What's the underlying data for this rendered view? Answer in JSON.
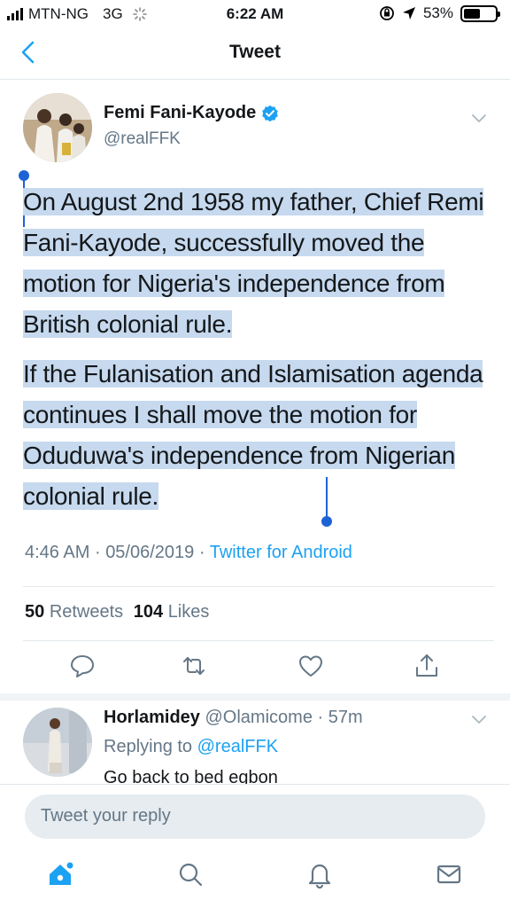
{
  "status_bar": {
    "carrier": "MTN-NG",
    "network": "3G",
    "time": "6:22 AM",
    "battery": "53%",
    "battery_level": 0.53
  },
  "nav": {
    "title": "Tweet",
    "back_icon": "chevron-left-icon"
  },
  "tweet": {
    "author_name": "Femi Fani-Kayode",
    "author_handle": "@realFFK",
    "paragraph_1": "On August 2nd 1958 my father, Chief Remi Fani-Kayode, successfully moved the motion for Nigeria's independence from British colonial rule.",
    "paragraph_2": "If the Fulanisation and Islamisation agenda continues I shall move the motion for Oduduwa's independence from Nigerian colonial rule.",
    "time": "4:46 AM",
    "sep": "·",
    "date": "05/06/2019",
    "source": "Twitter for Android",
    "retweet_count": "50",
    "retweet_label": "Retweets",
    "like_count": "104",
    "like_label": "Likes"
  },
  "reply": {
    "author_name": "Horlamidey",
    "author_handle": "@Olamicome",
    "sep": "·",
    "age": "57m",
    "replying_prefix": "Replying to",
    "replying_mention": "@realFFK",
    "text": "Go back to bed egbon"
  },
  "composer": {
    "placeholder": "Tweet your reply"
  },
  "tabs": [
    "home-icon",
    "search-icon",
    "notifications-icon",
    "messages-icon"
  ],
  "colors": {
    "accent": "#1da1f2",
    "selection": "#c6d9ee",
    "selection_handle": "#1d63d6",
    "secondary_text": "#657786"
  }
}
